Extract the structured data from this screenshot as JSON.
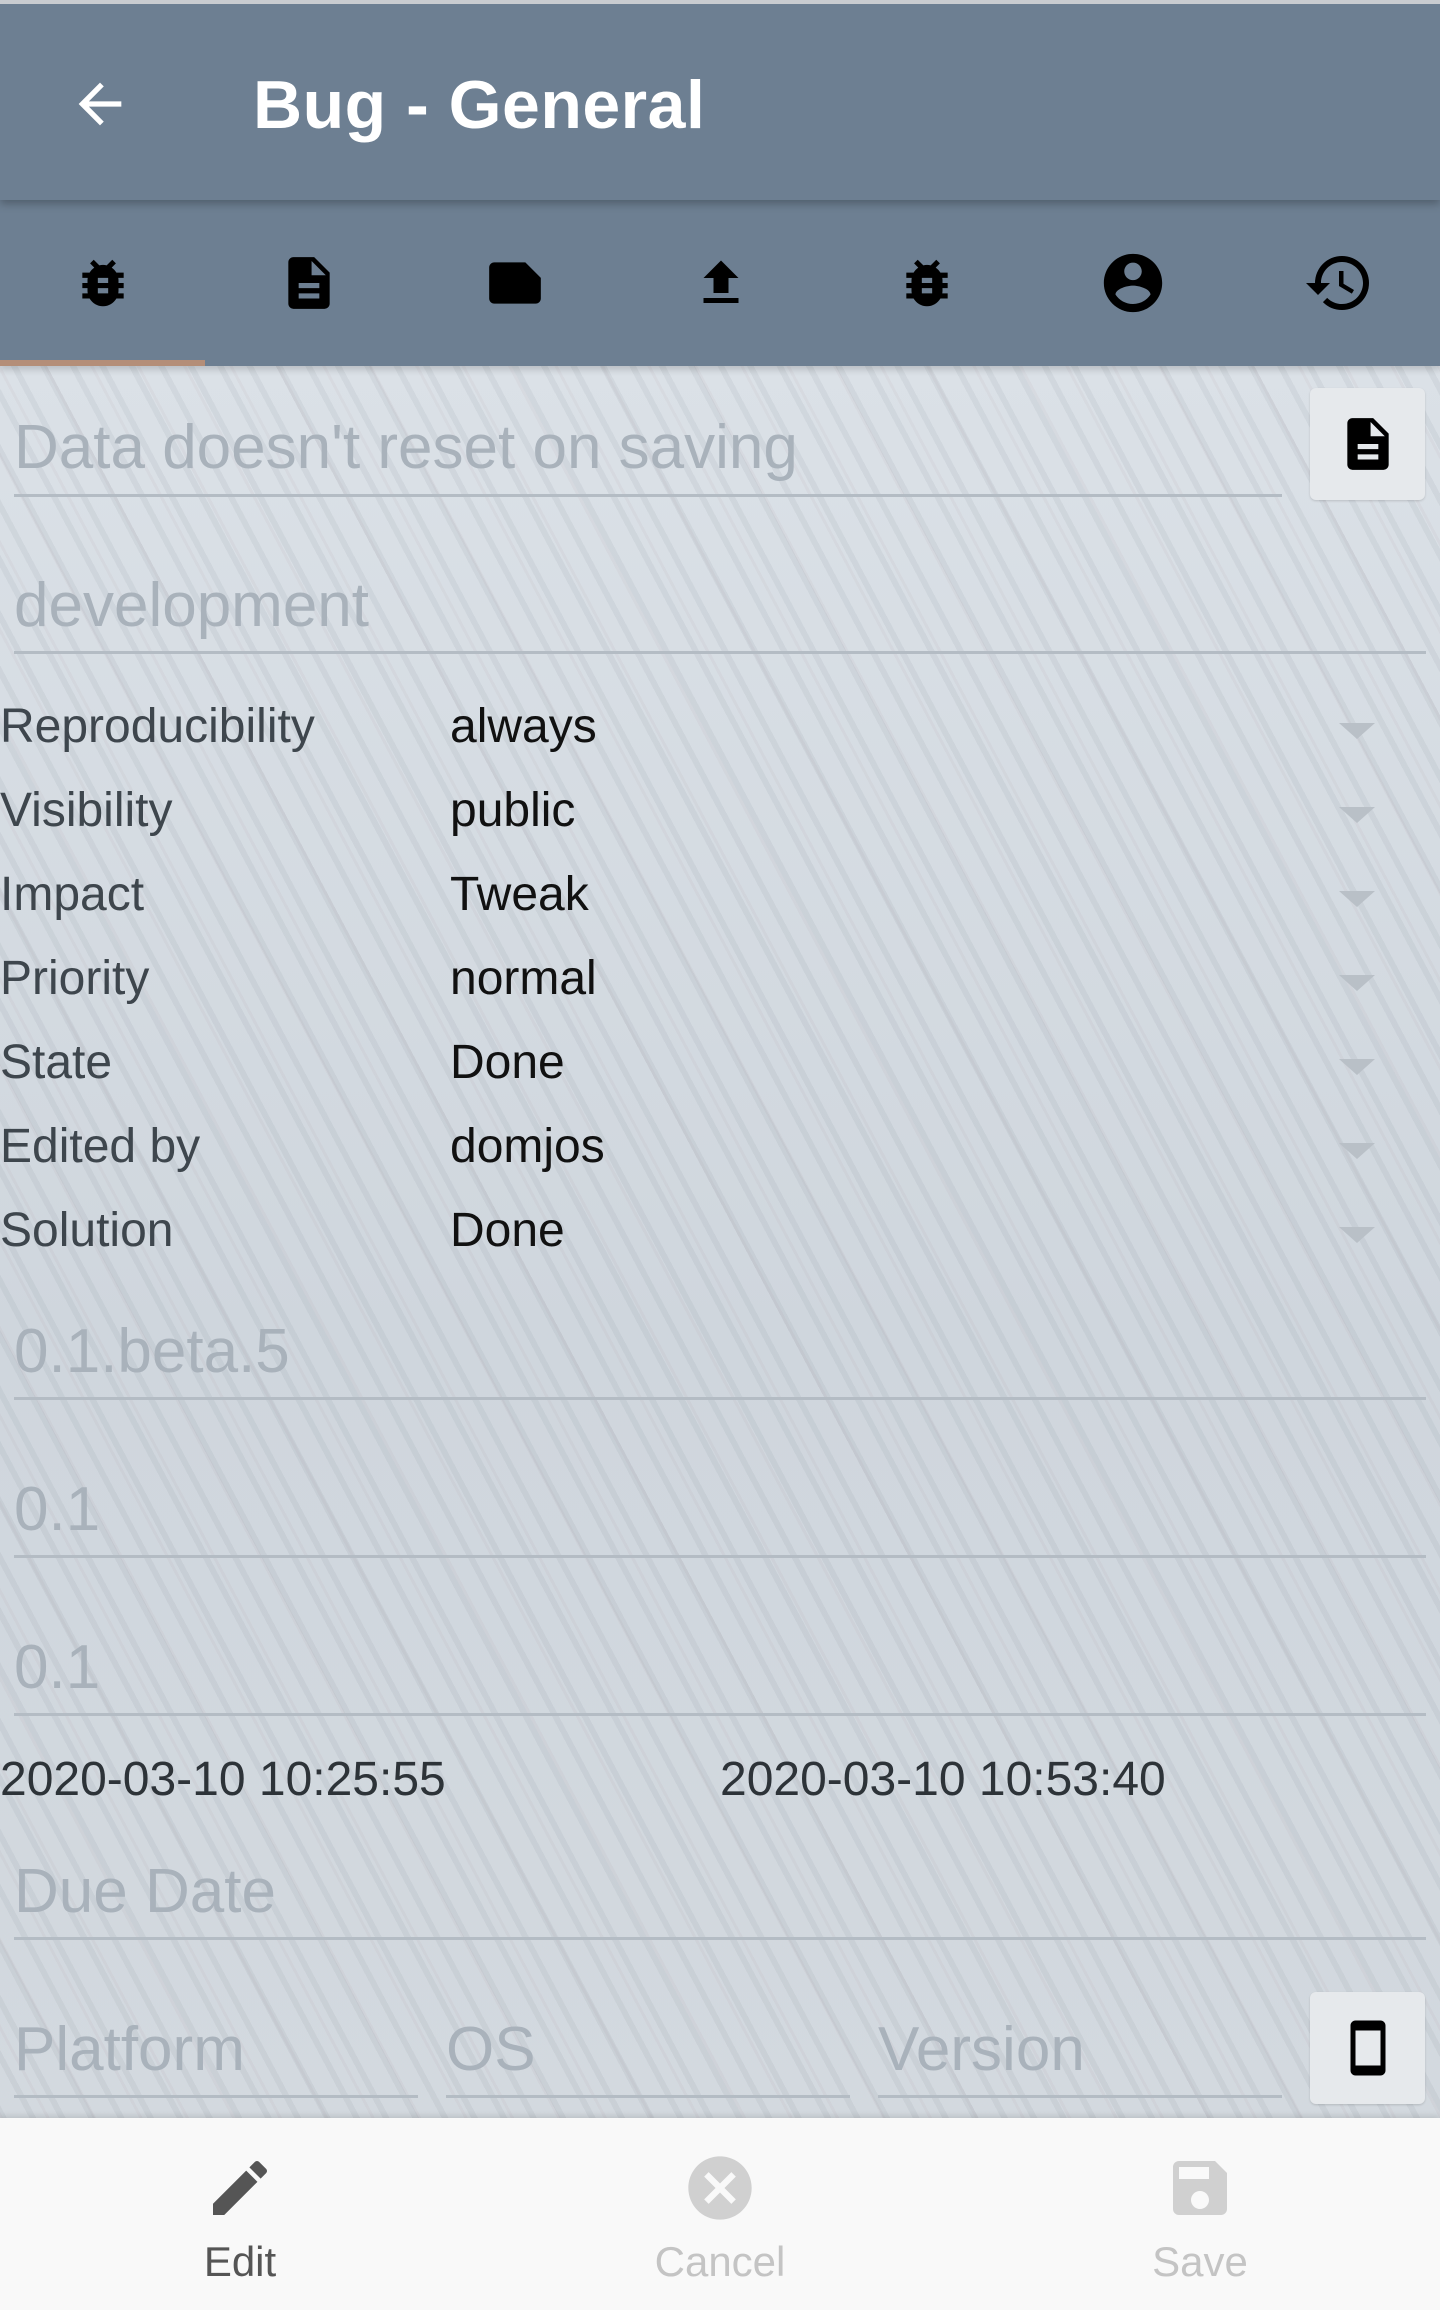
{
  "header": {
    "title": "Bug - General",
    "back_icon": "arrow-left-icon"
  },
  "tabs": [
    {
      "icon": "bug-icon",
      "active": true
    },
    {
      "icon": "document-icon"
    },
    {
      "icon": "note-icon"
    },
    {
      "icon": "upload-icon"
    },
    {
      "icon": "bug-icon"
    },
    {
      "icon": "user-circle-icon"
    },
    {
      "icon": "history-icon"
    }
  ],
  "form": {
    "summary": "Data doesn't reset on saving",
    "category": "development",
    "properties": [
      {
        "label": "Reproducibility",
        "value": "always"
      },
      {
        "label": "Visibility",
        "value": "public"
      },
      {
        "label": "Impact",
        "value": "Tweak"
      },
      {
        "label": "Priority",
        "value": "normal"
      },
      {
        "label": "State",
        "value": "Done"
      },
      {
        "label": "Edited by",
        "value": "domjos"
      },
      {
        "label": "Solution",
        "value": "Done"
      }
    ],
    "version": "0.1.beta.5",
    "target_version": "0.1",
    "fixed_version": "0.1",
    "created": "2020-03-10 10:25:55",
    "updated": "2020-03-10 10:53:40",
    "due_date_placeholder": "Due Date",
    "platform_placeholder": "Platform",
    "os_placeholder": "OS",
    "os_version_placeholder": "Version"
  },
  "actions": {
    "edit": "Edit",
    "cancel": "Cancel",
    "save": "Save"
  },
  "colors": {
    "toolbar": "#6d7f92",
    "accent_indicator": "#b48e78",
    "bottom_bar": "#f9f9f9"
  }
}
